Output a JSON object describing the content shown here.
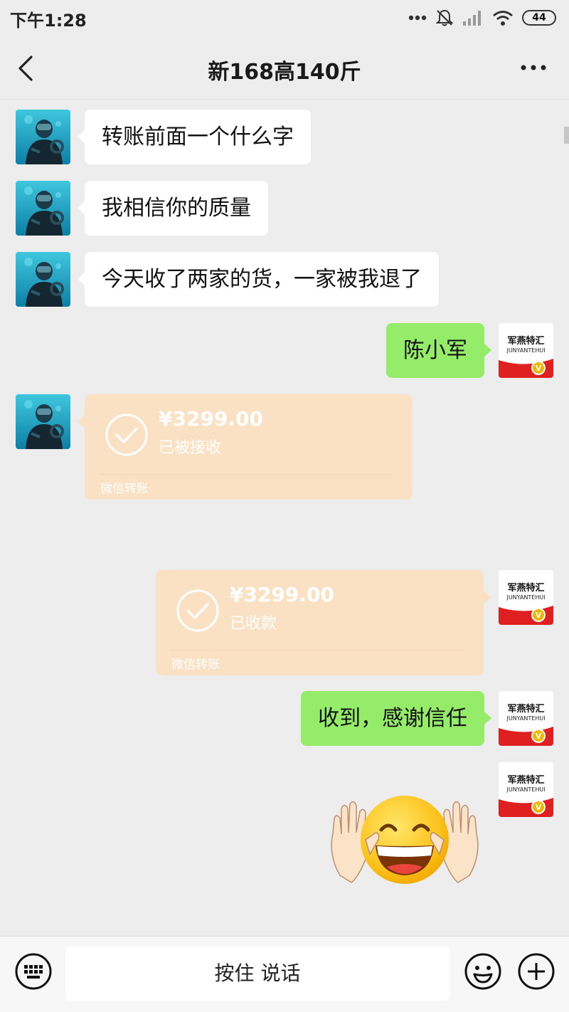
{
  "status_bar": {
    "time": "下午1:28",
    "battery": "44",
    "icons": [
      "more-dots-icon",
      "mute-bell-icon",
      "signal-icon",
      "wifi-icon",
      "battery-icon"
    ]
  },
  "header": {
    "title": "新168高140斤",
    "back_icon": "chevron-left-icon",
    "more_icon": "more-horizontal-icon"
  },
  "messages": [
    {
      "side": "left",
      "type": "text",
      "text": "转账前面一个什么字"
    },
    {
      "side": "left",
      "type": "text",
      "text": "我相信你的质量"
    },
    {
      "side": "left",
      "type": "text",
      "text": "今天收了两家的货，一家被我退了"
    },
    {
      "side": "right",
      "type": "text",
      "text": "陈小军"
    },
    {
      "side": "left",
      "type": "transfer",
      "amount": "¥3299.00",
      "status": "已被接收",
      "source": "微信转账"
    },
    {
      "side": "right",
      "type": "transfer",
      "amount": "¥3299.00",
      "status": "已收款",
      "source": "微信转账"
    },
    {
      "side": "right",
      "type": "text",
      "text": "收到，感谢信任"
    },
    {
      "side": "right",
      "type": "sticker",
      "sticker": "laughing-face-hands-sticker"
    }
  ],
  "self_avatar": {
    "logo_cn": "军燕特汇",
    "logo_en": "JUNYANTEHUI",
    "badge": "V"
  },
  "bottom_bar": {
    "keyboard_icon": "keyboard-icon",
    "voice_label": "按住 说话",
    "emoji_icon": "emoji-icon",
    "plus_icon": "plus-icon"
  },
  "colors": {
    "background": "#ededed",
    "outgoing_bubble": "#95ec69",
    "incoming_bubble": "#ffffff",
    "transfer_card": "#fbe1c4",
    "badge": "#f0b500",
    "logo_red": "#e02020"
  }
}
